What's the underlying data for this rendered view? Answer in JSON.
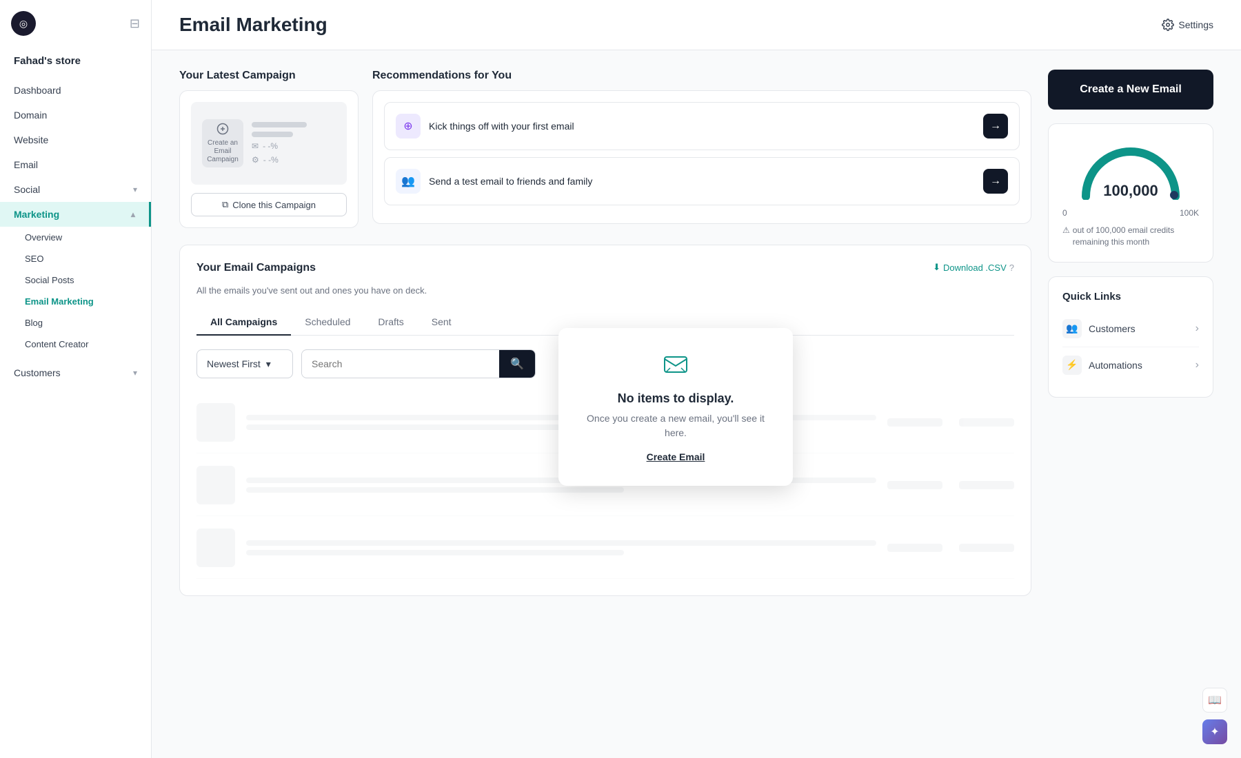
{
  "app": {
    "logo_char": "◎",
    "store_name": "Fahad's store"
  },
  "sidebar": {
    "nav_items": [
      {
        "label": "Dashboard",
        "active": false,
        "has_sub": false
      },
      {
        "label": "Domain",
        "active": false,
        "has_sub": false
      },
      {
        "label": "Website",
        "active": false,
        "has_sub": false
      },
      {
        "label": "Email",
        "active": false,
        "has_sub": false
      },
      {
        "label": "Social",
        "active": false,
        "has_sub": true,
        "expanded": true
      },
      {
        "label": "Marketing",
        "active": true,
        "has_sub": true,
        "expanded": true
      }
    ],
    "marketing_sub": [
      {
        "label": "Overview",
        "active": false
      },
      {
        "label": "SEO",
        "active": false
      },
      {
        "label": "Social Posts",
        "active": false
      },
      {
        "label": "Email Marketing",
        "active": true
      },
      {
        "label": "Blog",
        "active": false
      },
      {
        "label": "Content Creator",
        "active": false
      }
    ],
    "customers": {
      "label": "Customers",
      "has_sub": true
    }
  },
  "header": {
    "title": "Email Marketing",
    "settings_label": "Settings"
  },
  "latest_campaign": {
    "title": "Your Latest Campaign",
    "create_label": "Create an Email Campaign",
    "clone_btn": "Clone this Campaign"
  },
  "recommendations": {
    "title": "Recommendations for You",
    "items": [
      {
        "label": "Kick things off with your first email"
      },
      {
        "label": "Send a test email to friends and family"
      }
    ]
  },
  "email_campaigns": {
    "title": "Your Email Campaigns",
    "subtitle": "All the emails you've sent out and ones you have on deck.",
    "download_label": "Download .CSV",
    "tabs": [
      "All Campaigns",
      "Scheduled",
      "Drafts",
      "Sent"
    ],
    "active_tab": "All Campaigns",
    "sort_label": "Newest First",
    "search_placeholder": "Search"
  },
  "popup": {
    "title": "No items to display.",
    "description": "Once you create a new email, you'll see it here.",
    "link_label": "Create Email"
  },
  "right_panel": {
    "create_btn": "Create a New Email",
    "credits": {
      "value": "100,000",
      "min_label": "0",
      "max_label": "100K",
      "warning": "out of 100,000 email credits remaining this month"
    },
    "quick_links": {
      "title": "Quick Links",
      "items": [
        {
          "label": "Customers",
          "icon": "👥"
        },
        {
          "label": "Automations",
          "icon": "⚡"
        }
      ]
    }
  }
}
